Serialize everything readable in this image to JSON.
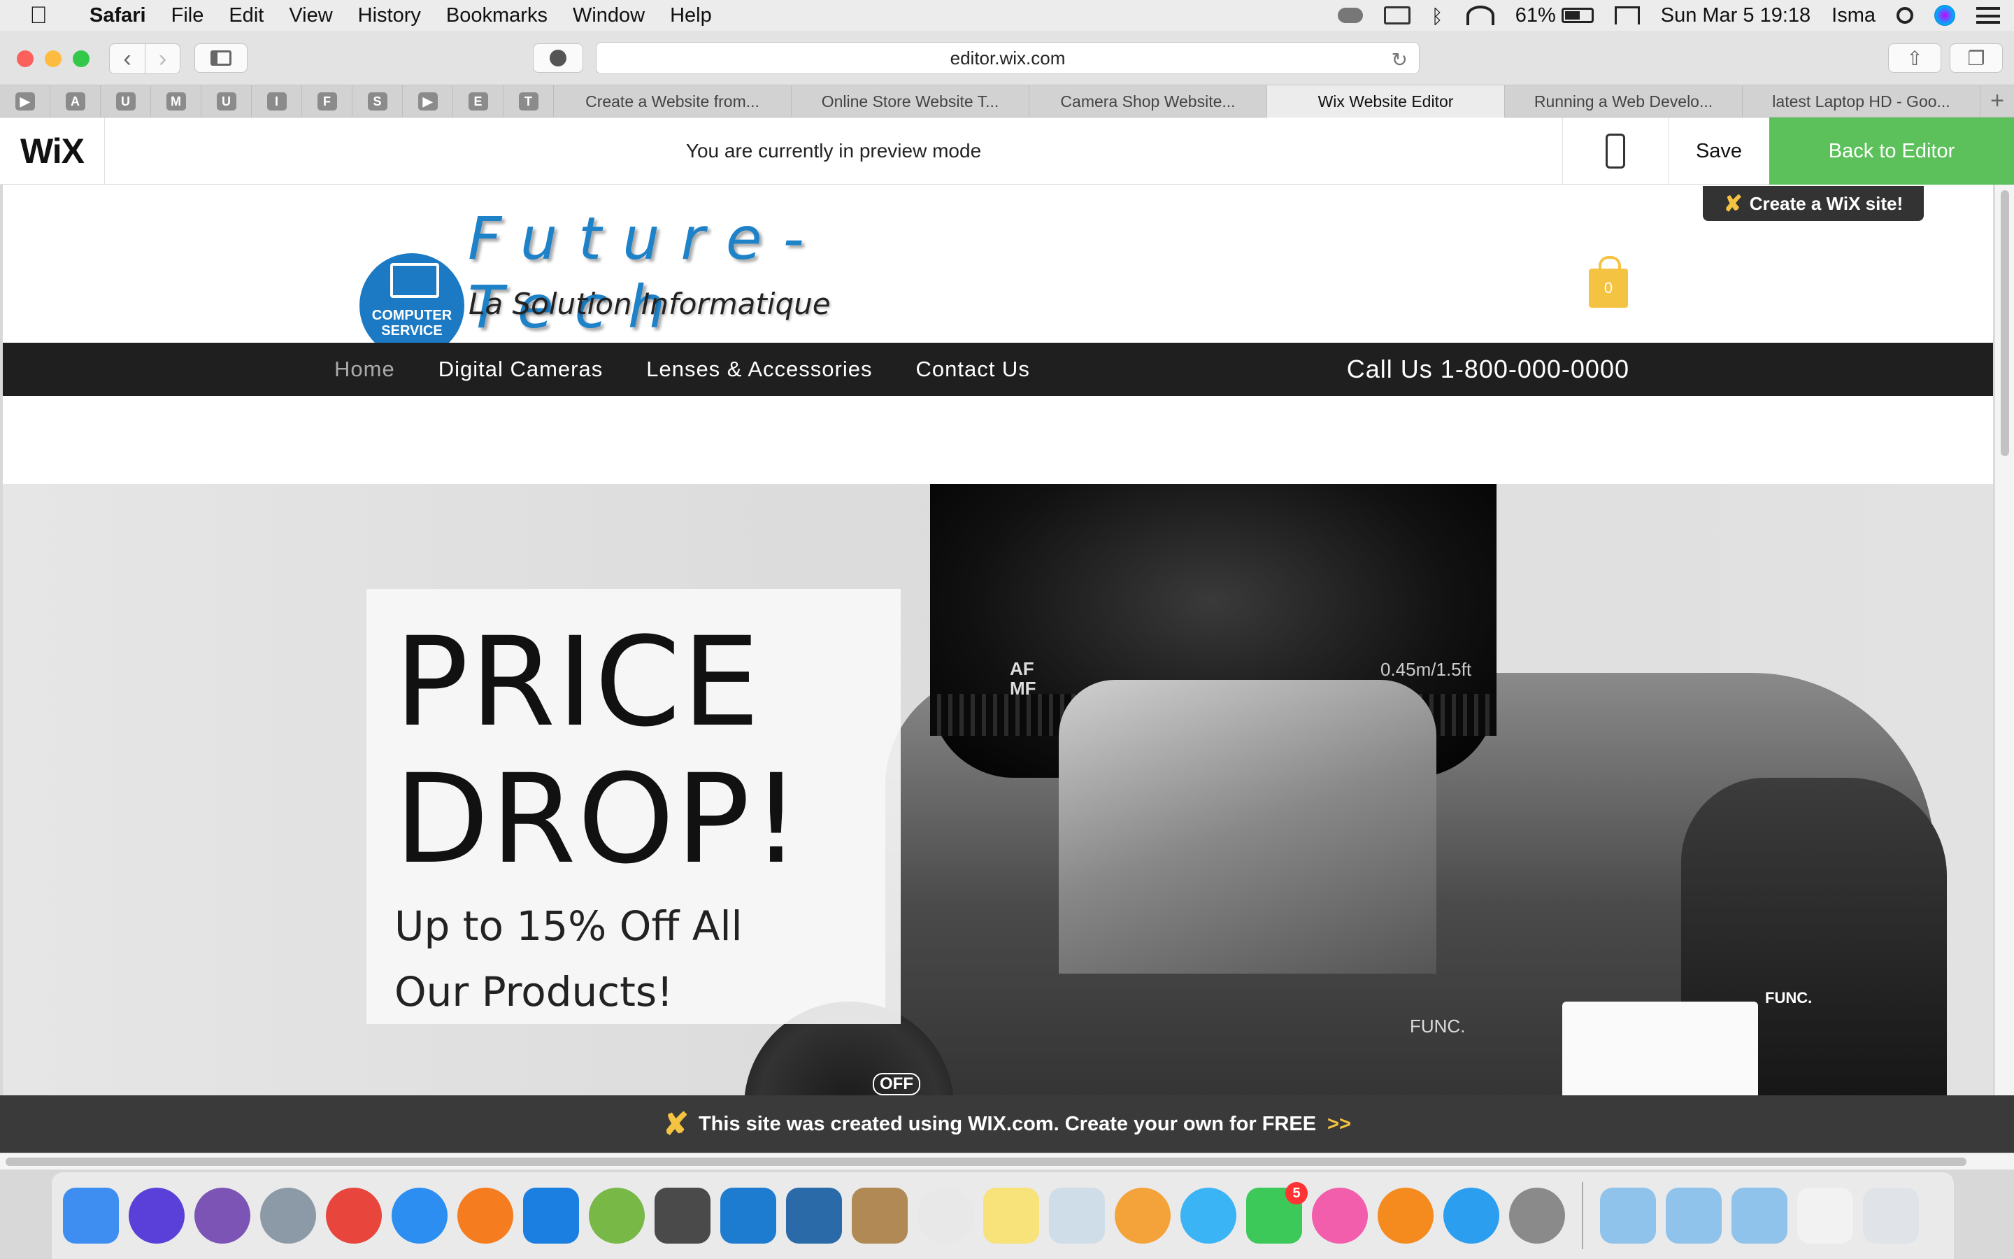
{
  "menubar": {
    "apple": "",
    "app_name": "Safari",
    "items": [
      "File",
      "Edit",
      "View",
      "History",
      "Bookmarks",
      "Window",
      "Help"
    ],
    "battery": "61%",
    "battery_fraction": 0.61,
    "datetime": "Sun Mar 5  19:18",
    "user": "Isma"
  },
  "browser": {
    "url": "editor.wix.com",
    "pinned_tabs": [
      "▶",
      "A",
      "U",
      "M",
      "U",
      "I",
      "F",
      "S",
      "▶",
      "E",
      "T"
    ],
    "tabs": [
      {
        "label": "Create a Website from...",
        "active": false
      },
      {
        "label": "Online Store Website T...",
        "active": false
      },
      {
        "label": "Camera Shop Website...",
        "active": false
      },
      {
        "label": "Wix Website Editor",
        "active": true
      },
      {
        "label": "Running a Web Develo...",
        "active": false
      },
      {
        "label": "latest Laptop HD - Goo...",
        "active": false
      }
    ],
    "new_tab": "+"
  },
  "wixbar": {
    "logo": "WiX",
    "preview_message": "You are currently in preview mode",
    "save": "Save",
    "back_to_editor": "Back to Editor"
  },
  "site": {
    "create_badge": "Create a WiX site!",
    "brand_title": "Future-Tech",
    "brand_subtitle": "La Solution Informatique",
    "logo_badge": [
      "COMPUTER",
      "SERVICE"
    ],
    "cart_count": "0",
    "nav": [
      "Home",
      "Digital Cameras",
      "Lenses & Accessories",
      "Contact Us"
    ],
    "phone": "Call Us 1-800-000-0000",
    "promo_line1": "PRICE",
    "promo_line2": "DROP!",
    "promo_sub1": "Up to 15% Off All",
    "promo_sub2": "Our Products!",
    "camera_labels": {
      "af_mf": "AF\nMF",
      "distance": "0.45m/1.5ft",
      "func": "FUNC.",
      "func_button": "FUNC.",
      "off": "OFF"
    }
  },
  "wix_banner": {
    "text": "This site was created using WIX.com. Create your own for FREE",
    "arrows": ">>"
  },
  "dock": {
    "apps": [
      {
        "name": "finder",
        "color": "#3d8ef0",
        "shape": "square"
      },
      {
        "name": "siri",
        "color": "#5a3fd8",
        "shape": "round"
      },
      {
        "name": "github-desktop",
        "color": "#7b54b5",
        "shape": "round"
      },
      {
        "name": "launchpad",
        "color": "#8c9aa8",
        "shape": "round"
      },
      {
        "name": "chrome",
        "color": "#e8453c",
        "shape": "round"
      },
      {
        "name": "safari",
        "color": "#2b8ef0",
        "shape": "round"
      },
      {
        "name": "firefox",
        "color": "#f57c1f",
        "shape": "round"
      },
      {
        "name": "xcode",
        "color": "#1a7fe0",
        "shape": "square"
      },
      {
        "name": "android-studio",
        "color": "#77b847",
        "shape": "round"
      },
      {
        "name": "sublime-text",
        "color": "#4a4a4a",
        "shape": "square"
      },
      {
        "name": "vscode",
        "color": "#1d7ccf",
        "shape": "square"
      },
      {
        "name": "brackets",
        "color": "#2b6aa8",
        "shape": "square"
      },
      {
        "name": "contacts",
        "color": "#b08954",
        "shape": "square"
      },
      {
        "name": "sequel-pro",
        "color": "#e8e8e8",
        "shape": "round"
      },
      {
        "name": "notes",
        "color": "#f8e27a",
        "shape": "square"
      },
      {
        "name": "preview",
        "color": "#cfdde8",
        "shape": "square"
      },
      {
        "name": "photos",
        "color": "#f4a23a",
        "shape": "round"
      },
      {
        "name": "messages",
        "color": "#3ab4f5",
        "shape": "round"
      },
      {
        "name": "facetime",
        "color": "#3dc95a",
        "shape": "square",
        "badge": "5"
      },
      {
        "name": "itunes",
        "color": "#f25dac",
        "shape": "round"
      },
      {
        "name": "ibooks",
        "color": "#f58a1f",
        "shape": "round"
      },
      {
        "name": "app-store",
        "color": "#2b9ef0",
        "shape": "round"
      },
      {
        "name": "system-preferences",
        "color": "#8a8a8a",
        "shape": "round"
      }
    ],
    "folders": [
      {
        "name": "documents-folder",
        "color": "#8fc3ec"
      },
      {
        "name": "applications-folder",
        "color": "#8fc3ec"
      },
      {
        "name": "downloads-folder",
        "color": "#8fc3ec"
      },
      {
        "name": "recent-screenshot",
        "color": "#f2f2f2"
      },
      {
        "name": "trash",
        "color": "#e0e4e8"
      }
    ]
  }
}
